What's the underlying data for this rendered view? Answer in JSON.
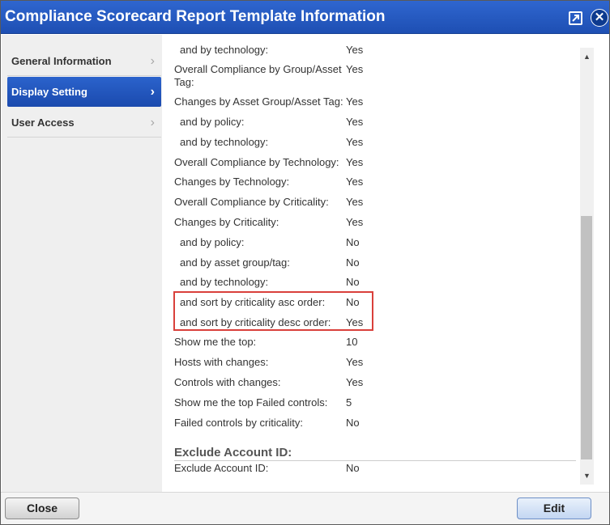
{
  "window": {
    "title": "Compliance Scorecard Report Template Information"
  },
  "sidebar": {
    "items": [
      {
        "label": "General Information",
        "active": false
      },
      {
        "label": "Display Setting",
        "active": true
      },
      {
        "label": "User Access",
        "active": false
      }
    ]
  },
  "settings": {
    "rows": [
      {
        "label": "and by technology:",
        "value": "Yes",
        "indent": true
      },
      {
        "label": "Overall Compliance by Group/Asset",
        "label2": "Tag:",
        "value": "Yes"
      },
      {
        "label": "Changes by Asset Group/Asset Tag:",
        "value": "Yes"
      },
      {
        "label": "and by policy:",
        "value": "Yes",
        "indent": true
      },
      {
        "label": "and by technology:",
        "value": "Yes",
        "indent": true
      },
      {
        "label": "Overall Compliance by Technology:",
        "value": "Yes"
      },
      {
        "label": "Changes by Technology:",
        "value": "Yes"
      },
      {
        "label": "Overall Compliance by Criticality:",
        "value": "Yes"
      },
      {
        "label": "Changes by Criticality:",
        "value": "Yes"
      },
      {
        "label": "and by policy:",
        "value": "No",
        "indent": true
      },
      {
        "label": "and by asset group/tag:",
        "value": "No",
        "indent": true
      },
      {
        "label": "and by technology:",
        "value": "No",
        "indent": true
      },
      {
        "label": "and sort by criticality asc order:",
        "value": "No",
        "indent": true
      },
      {
        "label": "and sort by criticality desc order:",
        "value": "Yes",
        "indent": true
      },
      {
        "label": "Show me the top:",
        "value": "10"
      },
      {
        "label": "Hosts with changes:",
        "value": "Yes"
      },
      {
        "label": "Controls with changes:",
        "value": "Yes"
      },
      {
        "label": "Show me the top Failed controls:",
        "value": "5"
      },
      {
        "label": "Failed controls by criticality:",
        "value": "No"
      }
    ],
    "exclude_section": {
      "heading": "Exclude Account ID:",
      "label": "Exclude Account ID:",
      "value": "No"
    }
  },
  "footer": {
    "close_label": "Close",
    "edit_label": "Edit"
  },
  "icons": {
    "popout": "popout-icon",
    "close": "close-icon",
    "chevron": "chevron-right-icon"
  }
}
